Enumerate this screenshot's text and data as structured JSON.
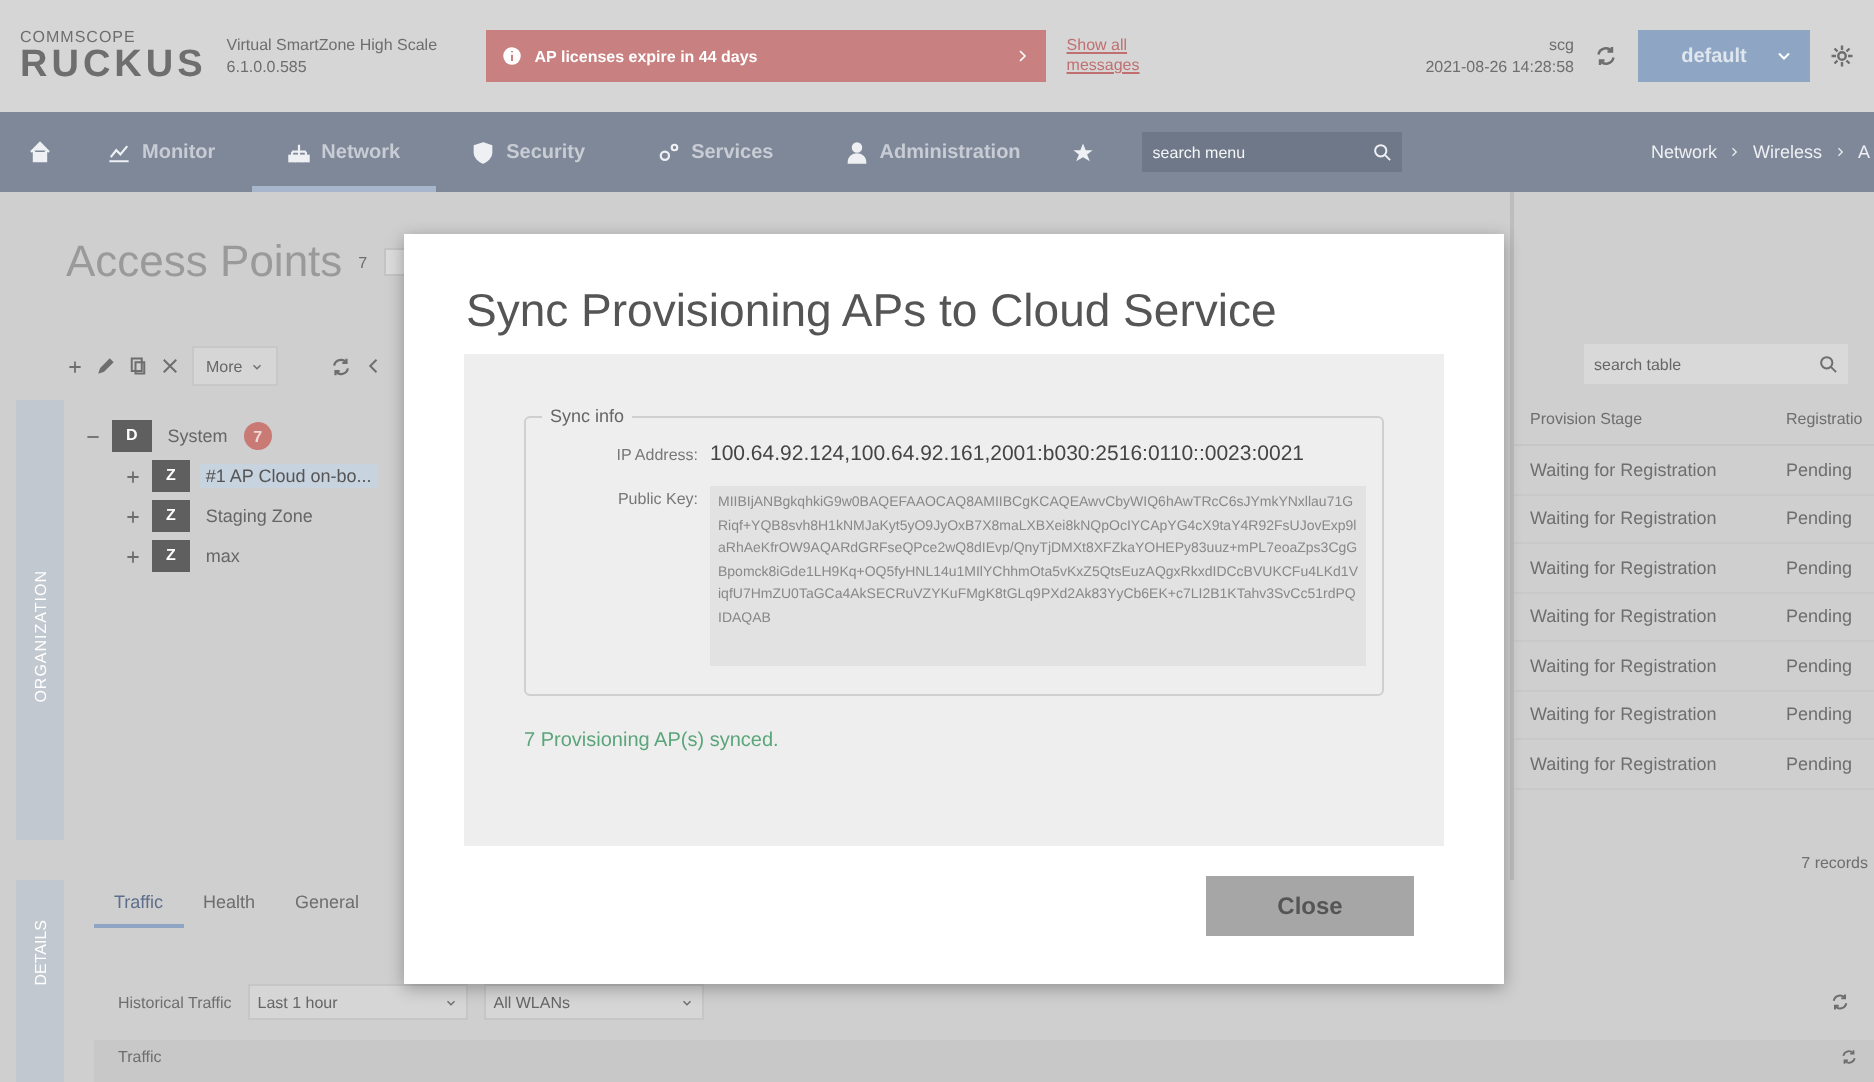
{
  "header": {
    "brand_top": "COMMSCOPE",
    "brand": "RUCKUS",
    "product": "Virtual SmartZone High Scale",
    "version": "6.1.0.0.585",
    "alert": "AP licenses expire in 44 days",
    "messages_link": "Show all messages",
    "host": "scg",
    "datetime": "2021-08-26 14:28:58",
    "domain": "default"
  },
  "nav": {
    "items": [
      {
        "label": "Monitor",
        "selected": false
      },
      {
        "label": "Network",
        "selected": true
      },
      {
        "label": "Security",
        "selected": false
      },
      {
        "label": "Services",
        "selected": false
      },
      {
        "label": "Administration",
        "selected": false
      }
    ],
    "search": {
      "placeholder": "search menu"
    },
    "breadcrumb": [
      "Network",
      "Wireless",
      "A"
    ]
  },
  "page": {
    "title": "Access Points",
    "count": "7",
    "more": "More",
    "org_tab": "ORGANIZATION"
  },
  "tree": [
    {
      "tag": "D",
      "label": "System",
      "badge": "7",
      "expanded": true,
      "selected": false,
      "children": [
        {
          "tag": "Z",
          "label": "#1 AP Cloud on-bo...",
          "expanded": false,
          "selected": true
        },
        {
          "tag": "Z",
          "label": "Staging Zone",
          "expanded": false,
          "selected": false
        },
        {
          "tag": "Z",
          "label": "max",
          "expanded": false,
          "selected": false
        }
      ]
    }
  ],
  "table": {
    "search": {
      "placeholder": "search table"
    },
    "columns": [
      "Provision Stage",
      "Registratio"
    ],
    "rows": [
      [
        "Waiting for Registration",
        "Pending"
      ],
      [
        "Waiting for Registration",
        "Pending"
      ],
      [
        "Waiting for Registration",
        "Pending"
      ],
      [
        "Waiting for Registration",
        "Pending"
      ],
      [
        "Waiting for Registration",
        "Pending"
      ],
      [
        "Waiting for Registration",
        "Pending"
      ],
      [
        "Waiting for Registration",
        "Pending"
      ]
    ],
    "footer": "7 records"
  },
  "details": {
    "side_tab": "DETAILS",
    "tabs": [
      {
        "label": "Traffic",
        "selected": true
      },
      {
        "label": "Health",
        "selected": false
      },
      {
        "label": "General",
        "selected": false
      }
    ],
    "historical_label": "Historical Traffic",
    "range": "Last 1 hour",
    "wlans": "All WLANs",
    "panel_title": "Traffic"
  },
  "dialog": {
    "title": "Sync Provisioning APs to Cloud Service",
    "legend": "Sync info",
    "fields": [
      {
        "kind": "text",
        "label": "IP Address:",
        "value": "100.64.92.124,100.64.92.161,2001:b030:2516:0110::0023:0021"
      },
      {
        "kind": "key",
        "label": "Public Key:",
        "value": "MIIBIjANBgkqhkiG9w0BAQEFAAOCAQ8AMIIBCgKCAQEAwvCbyWIQ6hAwTRcC6sJYmkYNxllau71GRiqf+YQB8svh8H1kNMJaKyt5yO9JyOxB7X8maLXBXei8kNQpOcIYCApYG4cX9taY4R92FsUJovExp9laRhAeKfrOW9AQARdGRFseQPce2wQ8dIEvp/QnyTjDMXt8XFZkaYOHEPy83uuz+mPL7eoaZps3CgGBpomck8iGde1LH9Kq+OQ5fyHNL14u1MIlYChhmOta5vKxZ5QtsEuzAQgxRkxdIDCcBVUKCFu4LKd1ViqfU7HmZU0TaGCa4AkSECRuVZYKuFMgK8tGLq9PXd2Ak83YyCb6EK+c7LI2B1KTahv3SvCc51rdPQIDAQAB"
      }
    ],
    "status": "7 Provisioning AP(s) synced.",
    "close": "Close"
  }
}
